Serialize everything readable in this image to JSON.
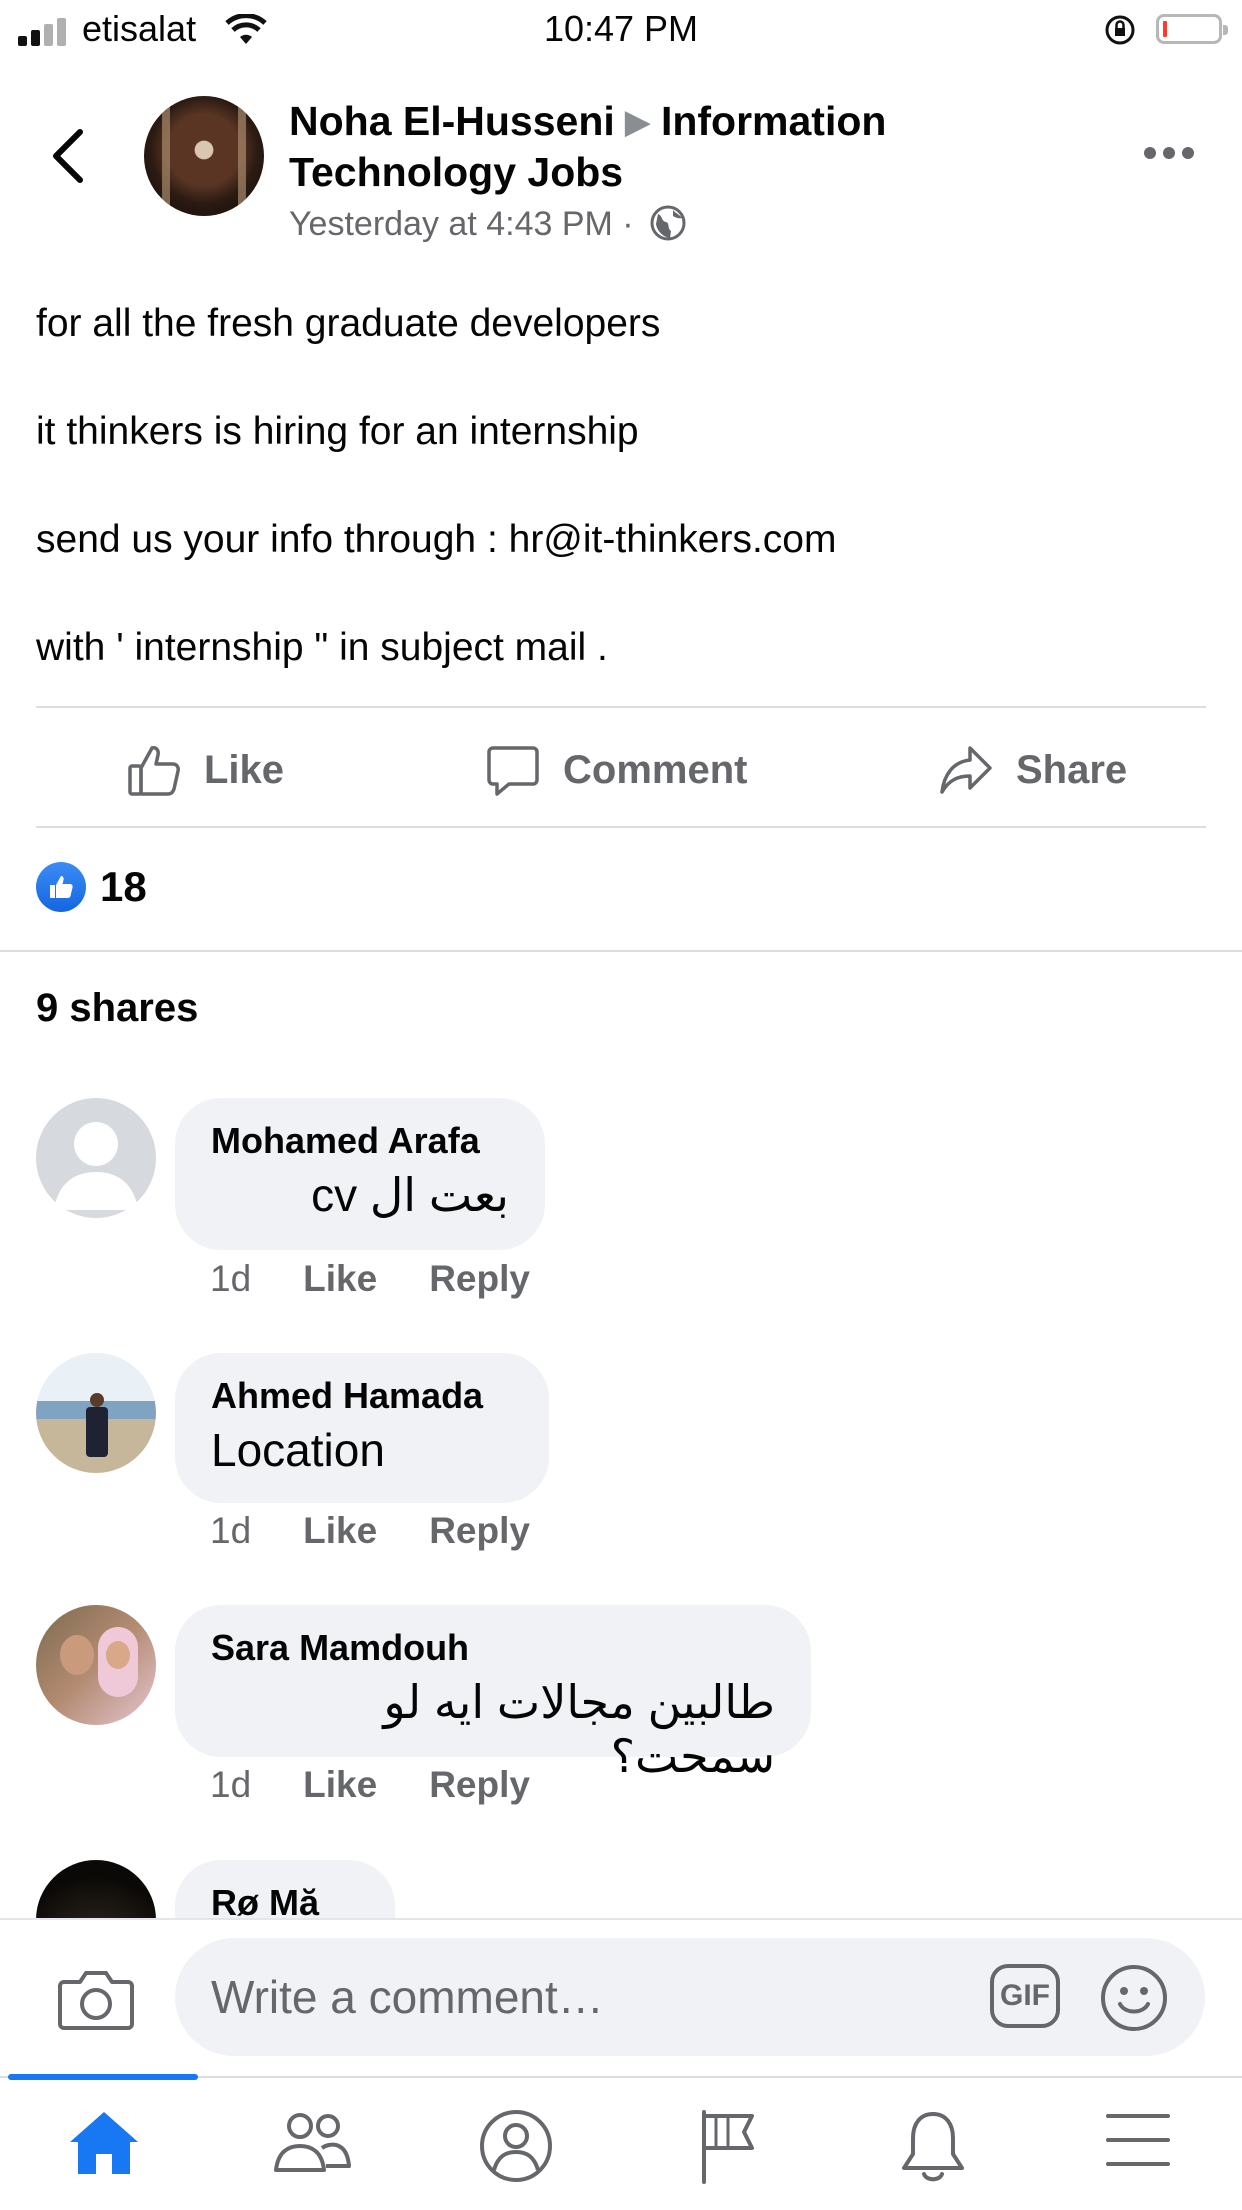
{
  "status_bar": {
    "carrier": "etisalat",
    "time": "10:47 PM"
  },
  "post": {
    "author": "Noha El-Husseni",
    "group": "Information Technology Jobs",
    "timestamp": "Yesterday at 4:43 PM",
    "separator": "·",
    "lines": [
      "for all the fresh graduate developers",
      "it thinkers is hiring for an internship",
      "send us your info through : hr@it-thinkers.com",
      "with ' internship \" in subject mail ."
    ],
    "actions": {
      "like": "Like",
      "comment": "Comment",
      "share": "Share"
    },
    "reaction_count": "18",
    "shares": "9 shares"
  },
  "comments": [
    {
      "name": "Mohamed Arafa",
      "text": "بعت ال cv",
      "rtl": true,
      "time": "1d",
      "like": "Like",
      "reply": "Reply"
    },
    {
      "name": "Ahmed Hamada",
      "text": "Location",
      "rtl": false,
      "time": "1d",
      "like": "Like",
      "reply": "Reply"
    },
    {
      "name": "Sara Mamdouh",
      "text": "طالبين مجالات ايه لو سمحت؟",
      "rtl": true,
      "time": "1d",
      "like": "Like",
      "reply": "Reply"
    },
    {
      "name": "Rø Mă"
    }
  ],
  "composer": {
    "placeholder": "Write a comment…",
    "gif_label": "GIF"
  },
  "icons": {
    "back": "chevron-left-icon",
    "more": "more-dots-icon",
    "audience": "globe-icon",
    "like": "thumbs-up-icon",
    "comment": "comment-icon",
    "share": "share-arrow-icon",
    "camera": "camera-icon",
    "emoji": "emoji-icon",
    "tabs": [
      "home-icon",
      "friends-icon",
      "profile-icon",
      "pages-icon",
      "notifications-icon",
      "menu-icon"
    ]
  },
  "colors": {
    "accent": "#1877f2",
    "secondary_text": "#65676b",
    "bubble": "#f0f2f5"
  }
}
